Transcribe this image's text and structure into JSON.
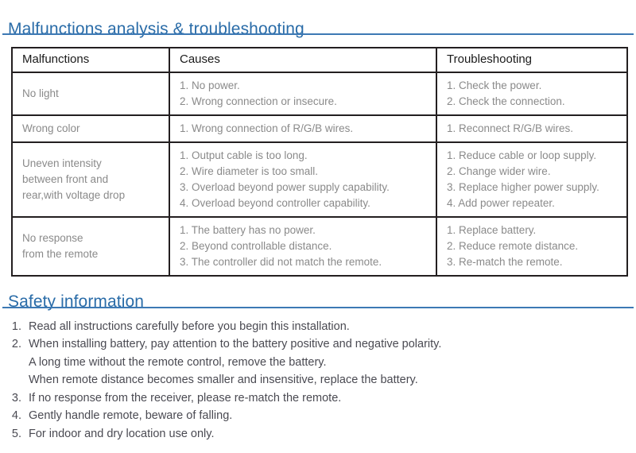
{
  "document": {
    "sections": [
      {
        "id": "malfunctions",
        "title": "Malfunctions analysis & troubleshooting"
      },
      {
        "id": "safety",
        "title": "Safety information"
      }
    ]
  },
  "colors": {
    "heading_blue": "#2a6ca8",
    "rule_blue": "#3d79b4",
    "table_border": "#231f20",
    "table_header_text": "#1a1a1a",
    "table_body_text": "#8a8a8a",
    "list_text": "#4a4a52"
  },
  "table": {
    "headers": [
      "Malfunctions",
      "Causes",
      "Troubleshooting"
    ],
    "rows": [
      {
        "malfunction": [
          "No light"
        ],
        "causes": [
          "1. No power.",
          "2. Wrong connection or insecure."
        ],
        "troubleshooting": [
          "1. Check the power.",
          "2. Check the connection."
        ]
      },
      {
        "malfunction": [
          "Wrong color"
        ],
        "causes": [
          "1. Wrong connection of R/G/B wires."
        ],
        "troubleshooting": [
          "1. Reconnect R/G/B wires."
        ]
      },
      {
        "malfunction": [
          "Uneven intensity",
          "between front and",
          "rear,with voltage drop"
        ],
        "causes": [
          "1. Output cable is too long.",
          "2. Wire diameter is too small.",
          "3. Overload beyond power supply capability.",
          "4. Overload beyond controller capability."
        ],
        "troubleshooting": [
          "1. Reduce cable or loop supply.",
          "2. Change wider wire.",
          "3. Replace higher power supply.",
          "4. Add power repeater."
        ]
      },
      {
        "malfunction": [
          "No response",
          "from the remote"
        ],
        "causes": [
          "1. The battery has no power.",
          "2. Beyond controllable distance.",
          "3. The controller did not match the remote."
        ],
        "troubleshooting": [
          "1. Replace battery.",
          "2. Reduce remote distance.",
          "3. Re-match the remote."
        ]
      }
    ]
  },
  "safety": {
    "items": [
      {
        "number": "1.",
        "lines": [
          "Read all instructions carefully before you begin this installation."
        ]
      },
      {
        "number": "2.",
        "lines": [
          "When installing battery, pay attention to the battery positive and negative polarity.",
          "A long time without the remote control, remove the battery.",
          "When remote distance becomes smaller and insensitive, replace the battery."
        ]
      },
      {
        "number": "3.",
        "lines": [
          "If no response from the receiver, please re-match the remote."
        ]
      },
      {
        "number": "4.",
        "lines": [
          "Gently handle remote, beware of falling."
        ]
      },
      {
        "number": "5.",
        "lines": [
          "For indoor and dry location use only."
        ]
      }
    ]
  }
}
